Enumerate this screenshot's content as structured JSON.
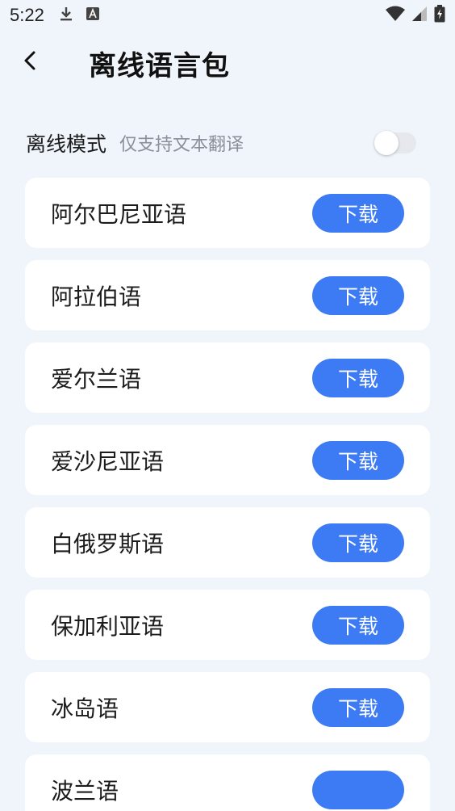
{
  "status_bar": {
    "time": "5:22",
    "icons": [
      "download-icon",
      "a-icon",
      "wifi-icon",
      "signal-icon",
      "battery-icon"
    ]
  },
  "header": {
    "title": "离线语言包",
    "back_icon": "back-arrow-icon"
  },
  "offline_mode": {
    "label": "离线模式",
    "subtitle": "仅支持文本翻译",
    "enabled": false
  },
  "languages": [
    {
      "name": "阿尔巴尼亚语",
      "button": "下载"
    },
    {
      "name": "阿拉伯语",
      "button": "下载"
    },
    {
      "name": "爱尔兰语",
      "button": "下载"
    },
    {
      "name": "爱沙尼亚语",
      "button": "下载"
    },
    {
      "name": "白俄罗斯语",
      "button": "下载"
    },
    {
      "name": "保加利亚语",
      "button": "下载"
    },
    {
      "name": "冰岛语",
      "button": "下载"
    },
    {
      "name": "波兰语",
      "button": ""
    }
  ],
  "colors": {
    "background": "#f0f4fb",
    "card": "#ffffff",
    "accent": "#3d7bf5"
  }
}
